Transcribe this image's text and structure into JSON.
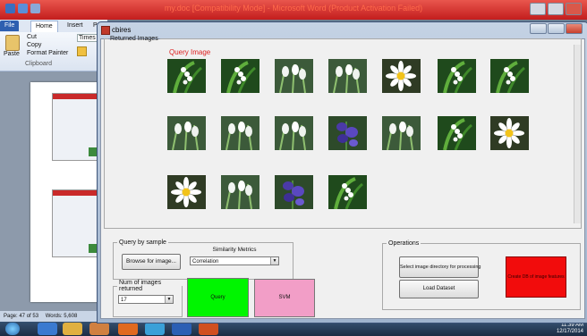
{
  "word": {
    "title": "my.doc [Compatibility Mode] - Microsoft Word (Product Activation Failed)",
    "tabs": [
      "File",
      "Home",
      "Insert",
      "Pa"
    ],
    "ribbon": {
      "cut": "Cut",
      "copy": "Copy",
      "paste": "Paste",
      "format_painter": "Format Painter",
      "clipboard": "Clipboard",
      "font_name": "Times Ne"
    },
    "status": {
      "page": "Page: 47 of 53",
      "words": "Words: 5,608"
    }
  },
  "taskbar": {
    "time": "11:39 AM",
    "date": "12/17/2014"
  },
  "app": {
    "title": "cbires",
    "returned_images_legend": "Returned Images",
    "query_image_label": "Query Image",
    "query_by_sample_legend": "Query by sample",
    "browse_button": "Browse for image...",
    "similarity_label": "Similarity Metrics",
    "similarity_value": "Correlation",
    "num_images_legend": "Num of images returned",
    "num_images_value": "17",
    "query_button": "Query",
    "svm_button": "SVM",
    "operations_legend": "Operations",
    "select_dir_button": "Select image directory for processing",
    "load_button": "Load Dataset",
    "create_db_button": "Create DB of image features",
    "colors": {
      "query_button": "#00f500",
      "svm_button": "#f29ec7",
      "create_db_button": "#f20c0c",
      "query_label": "#dd2222"
    }
  },
  "images": [
    {
      "type": "lily-of-valley"
    },
    {
      "type": "lily-of-valley"
    },
    {
      "type": "snowdrop"
    },
    {
      "type": "snowdrop"
    },
    {
      "type": "daisy"
    },
    {
      "type": "lily-of-valley"
    },
    {
      "type": "lily-of-valley"
    },
    {
      "type": "snowdrop"
    },
    {
      "type": "snowdrop"
    },
    {
      "type": "snowdrop"
    },
    {
      "type": "bluebell"
    },
    {
      "type": "snowdrop"
    },
    {
      "type": "lily-of-valley"
    },
    {
      "type": "daisy"
    },
    {
      "type": "daisy"
    },
    {
      "type": "snowdrop"
    },
    {
      "type": "bluebell"
    },
    {
      "type": "lily-of-valley"
    }
  ]
}
